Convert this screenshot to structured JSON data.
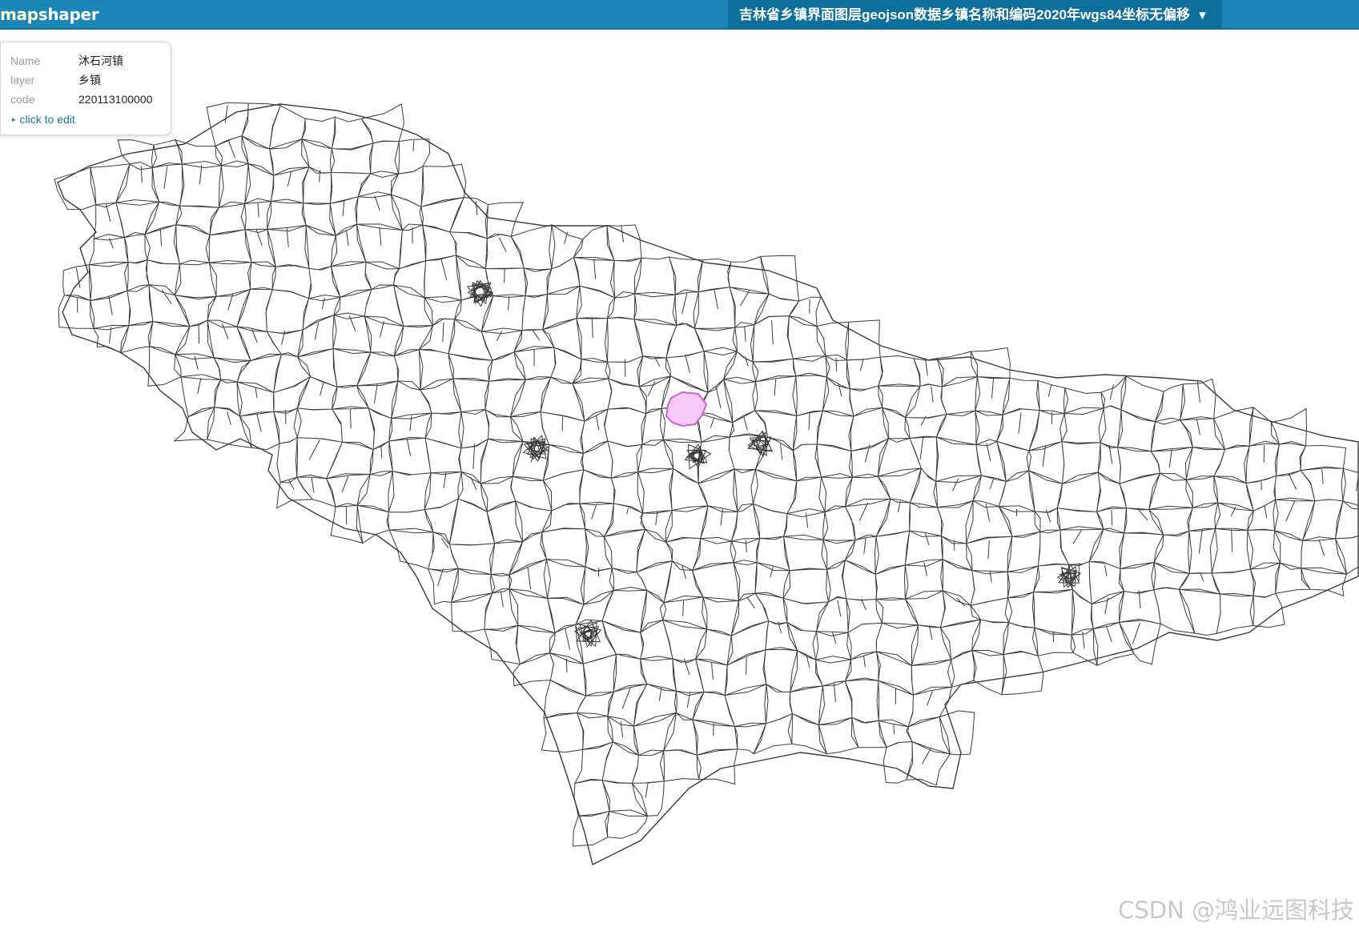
{
  "app": {
    "logo_prefix": "map",
    "logo_suffix": "shaper"
  },
  "layer_menu": {
    "label": "吉林省乡镇界面图层geojson数据乡镇名称和编码2020年wgs84坐标无偏移",
    "arrow": "▼"
  },
  "info_panel": {
    "rows": [
      {
        "key": "Name",
        "value": "沐石河镇"
      },
      {
        "key": "layer",
        "value": "乡镇"
      },
      {
        "key": "code",
        "value": "220113100000"
      }
    ],
    "edit_label": "click to edit",
    "edit_arrow": "▸"
  },
  "map": {
    "stroke_color": "#3a3a3a",
    "fill_color": "#ffffff",
    "selected_fill": "#f7c9f5",
    "selected_stroke": "#d05fd0"
  },
  "watermark": "CSDN @鸿业远图科技"
}
